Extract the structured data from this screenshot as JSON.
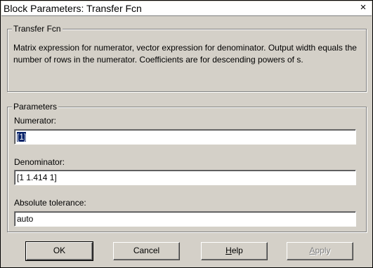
{
  "window": {
    "title": "Block Parameters: Transfer Fcn",
    "close_glyph": "×"
  },
  "description_group": {
    "legend": "Transfer Fcn",
    "text": "Matrix expression for numerator, vector expression for denominator.  Output width equals the number of rows in the numerator.  Coefficients are for descending powers of s."
  },
  "parameters_group": {
    "legend": "Parameters",
    "numerator": {
      "label": "Numerator:",
      "value": "[1]"
    },
    "denominator": {
      "label": "Denominator:",
      "value": "[1 1.414 1]"
    },
    "tolerance": {
      "label": "Absolute tolerance:",
      "value": "auto"
    }
  },
  "buttons": {
    "ok": "OK",
    "cancel": "Cancel",
    "help_mnemonic": "H",
    "help_rest": "elp",
    "apply_mnemonic": "A",
    "apply_rest": "pply"
  }
}
